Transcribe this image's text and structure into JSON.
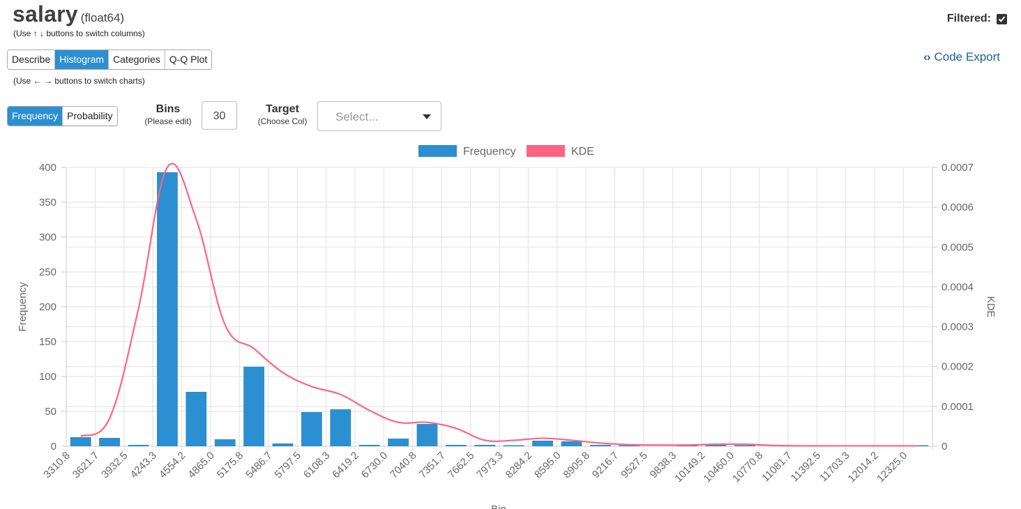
{
  "header": {
    "column_name": "salary",
    "column_type": "(float64)",
    "column_hint": "(Use ↑ ↓ buttons to switch columns)",
    "filtered_label": "Filtered:",
    "chart_hint": "(Use ← → buttons to switch charts)"
  },
  "chart_tabs": [
    {
      "label": "Describe",
      "active": false
    },
    {
      "label": "Histogram",
      "active": true
    },
    {
      "label": "Categories",
      "active": false
    },
    {
      "label": "Q-Q Plot",
      "active": false
    }
  ],
  "code_export": {
    "icon": "code-icon",
    "label": "Code Export"
  },
  "mode_toggle": [
    {
      "label": "Frequency",
      "active": true
    },
    {
      "label": "Probability",
      "active": false
    }
  ],
  "bins": {
    "label": "Bins",
    "sublabel": "(Please edit)",
    "value": "30"
  },
  "target": {
    "label": "Target",
    "sublabel": "(Choose Col)",
    "placeholder": "Select..."
  },
  "colors": {
    "bar": "#2b8fd1",
    "kde": "#ff6384",
    "active_button": "#2b8fd1",
    "link": "#1e5f9a"
  },
  "chart_data": {
    "type": "bar",
    "legend": [
      "Frequency",
      "KDE"
    ],
    "legend_position": "top",
    "grid": true,
    "xlabel": "Bin",
    "ylabel": "Frequency",
    "y2label": "KDE",
    "ylim": [
      0,
      400
    ],
    "y_ticks": [
      "0",
      "50",
      "100",
      "150",
      "200",
      "250",
      "300",
      "350",
      "400"
    ],
    "y2lim": [
      0,
      0.0007
    ],
    "y2_ticks": [
      "0",
      "0.0001",
      "0.0002",
      "0.0003",
      "0.0004",
      "0.0005",
      "0.0006",
      "0.0007"
    ],
    "categories": [
      "3310.8",
      "3621.7",
      "3932.5",
      "4243.3",
      "4554.2",
      "4865.0",
      "5175.8",
      "5486.7",
      "5797.5",
      "6108.3",
      "6419.2",
      "6730.0",
      "7040.8",
      "7351.7",
      "7662.5",
      "7973.3",
      "8284.2",
      "8595.0",
      "8905.8",
      "9216.7",
      "9527.5",
      "9838.3",
      "10149.2",
      "10460.0",
      "10770.8",
      "11081.7",
      "11392.5",
      "11703.3",
      "12014.2",
      "12325.0"
    ],
    "series": [
      {
        "name": "Frequency",
        "type": "bar",
        "values": [
          13,
          12,
          2,
          393,
          78,
          10,
          114,
          4,
          49,
          53,
          2,
          11,
          32,
          2,
          2,
          1,
          8,
          7,
          2,
          1,
          0,
          1,
          3,
          1,
          0,
          0,
          0,
          0,
          0,
          1
        ]
      },
      {
        "name": "KDE",
        "type": "line",
        "values": [
          2.5e-05,
          7e-05,
          0.000345,
          0.0007,
          0.00057,
          0.000305,
          0.000245,
          0.000185,
          0.00015,
          0.00013,
          9e-05,
          6e-05,
          6e-05,
          4.5e-05,
          1.5e-05,
          1.5e-05,
          2e-05,
          1.5e-05,
          8e-06,
          4e-06,
          3e-06,
          3e-06,
          5e-06,
          5e-06,
          2e-06,
          1e-06,
          1e-06,
          1e-06,
          1e-06,
          1e-06
        ]
      }
    ]
  }
}
